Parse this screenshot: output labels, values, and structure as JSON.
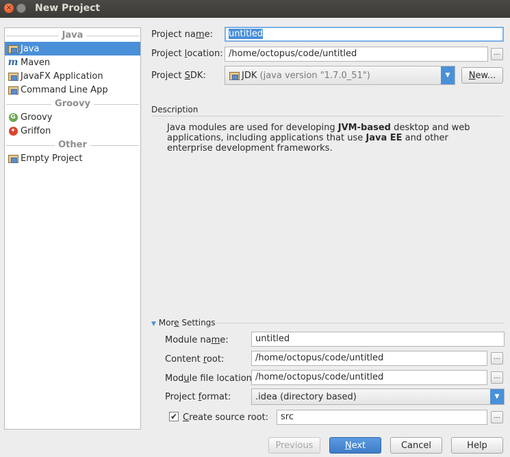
{
  "window": {
    "title": "New Project"
  },
  "left_panel": {
    "groups": [
      {
        "header": "Java",
        "items": [
          {
            "label": "Java",
            "icon": "java-folder-icon",
            "selected": true
          },
          {
            "label": "Maven",
            "icon": "maven-icon"
          },
          {
            "label": "JavaFX Application",
            "icon": "javafx-folder-icon"
          },
          {
            "label": "Command Line App",
            "icon": "command-line-folder-icon"
          }
        ]
      },
      {
        "header": "Groovy",
        "items": [
          {
            "label": "Groovy",
            "icon": "groovy-icon"
          },
          {
            "label": "Griffon",
            "icon": "griffon-icon"
          }
        ]
      },
      {
        "header": "Other",
        "items": [
          {
            "label": "Empty Project",
            "icon": "empty-project-folder-icon"
          }
        ]
      }
    ]
  },
  "form": {
    "project_name": {
      "label_pre": "Project na",
      "label_u": "m",
      "label_post": "e:",
      "value": "untitled"
    },
    "project_location": {
      "label_pre": "Project ",
      "label_u": "l",
      "label_post": "ocation:",
      "value": "/home/octopus/code/untitled",
      "browse": "..."
    },
    "project_sdk": {
      "label_pre": "Project ",
      "label_u": "S",
      "label_post": "DK:",
      "value_main": "JDK",
      "value_detail": "(java version \"1.7.0_51\")",
      "new_pre": "",
      "new_u": "N",
      "new_post": "ew..."
    }
  },
  "description": {
    "heading": "Description",
    "p1": "Java modules are used for developing ",
    "b1": "JVM-based",
    "p2": " desktop and web applications, including applications that use ",
    "b2": "Java EE",
    "p3": " and other enterprise development frameworks."
  },
  "more_settings": {
    "toggle_pre": "Mor",
    "toggle_u": "e",
    "toggle_post": " Settings",
    "module_name": {
      "label_pre": "Module na",
      "label_u": "m",
      "label_post": "e:",
      "value": "untitled"
    },
    "content_root": {
      "label_pre": "Content ",
      "label_u": "r",
      "label_post": "oot:",
      "value": "/home/octopus/code/untitled"
    },
    "module_file_location": {
      "label_pre": "Mod",
      "label_u": "u",
      "label_post": "le file location:",
      "value": "/home/octopus/code/untitled"
    },
    "project_format": {
      "label_pre": "Project ",
      "label_u": "f",
      "label_post": "ormat:",
      "value": ".idea (directory based)"
    },
    "create_source_root": {
      "label_pre": "",
      "label_u": "C",
      "label_post": "reate source root:",
      "checked": true,
      "value": "src"
    }
  },
  "buttons": {
    "previous": "Previous",
    "next_u": "N",
    "next_post": "ext",
    "cancel": "Cancel",
    "help": "Help"
  },
  "colors": {
    "selection": "#4a90d9",
    "titlebar": "#3c3b37",
    "primary_button": "#3e7cc6"
  }
}
